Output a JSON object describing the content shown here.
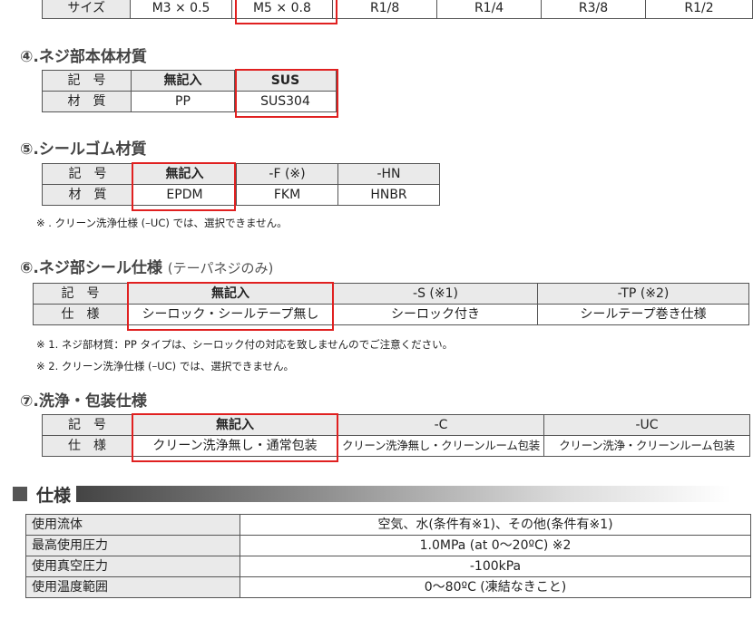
{
  "size_table": {
    "label": "サイズ",
    "values": [
      "M3 × 0.5",
      "M5 × 0.8",
      "R1/8",
      "R1/4",
      "R3/8",
      "R1/2"
    ]
  },
  "section4": {
    "title": "④.ネジ部本体材質",
    "row1": [
      "記　号",
      "無記入",
      "SUS"
    ],
    "row2": [
      "材　質",
      "PP",
      "SUS304"
    ]
  },
  "section5": {
    "title": "⑤.シールゴム材質",
    "row1": [
      "記　号",
      "無記入",
      "-F (※)",
      "-HN"
    ],
    "row2": [
      "材　質",
      "EPDM",
      "FKM",
      "HNBR"
    ],
    "note": "※ . クリーン洗浄仕様 (–UC) では、選択できません。"
  },
  "section6": {
    "title": "⑥.ネジ部シール仕様",
    "subtitle": "(テーパネジのみ)",
    "row1": [
      "記　号",
      "無記入",
      "-S (※1)",
      "-TP (※2)"
    ],
    "row2": [
      "仕　様",
      "シーロック・シールテープ無し",
      "シーロック付き",
      "シールテープ巻き仕様"
    ],
    "note1": "※ 1. ネジ部材質：PP タイプは、シーロック付の対応を致しませんのでご注意ください。",
    "note2": "※ 2. クリーン洗浄仕様 (–UC) では、選択できません。"
  },
  "section7": {
    "title": "⑦.洗浄・包装仕様",
    "row1": [
      "記　号",
      "無記入",
      "-C",
      "-UC"
    ],
    "row2": [
      "仕　様",
      "クリーン洗浄無し・通常包装",
      "クリーン洗浄無し・クリーンルーム包装",
      "クリーン洗浄・クリーンルーム包装"
    ]
  },
  "spec": {
    "title": "仕様",
    "rows": [
      {
        "label": "使用流体",
        "value": "空気、水(条件有※1)、その他(条件有※1)"
      },
      {
        "label": "最高使用圧力",
        "value": "1.0MPa (at 0～20ºC) ※2"
      },
      {
        "label": "使用真空圧力",
        "value": "-100kPa"
      },
      {
        "label": "使用温度範囲",
        "value": "0～80ºC (凍結なきこと)"
      }
    ]
  },
  "colors": {
    "highlight": "#e02020",
    "header_bg": "#eaeaea",
    "border": "#555555"
  }
}
